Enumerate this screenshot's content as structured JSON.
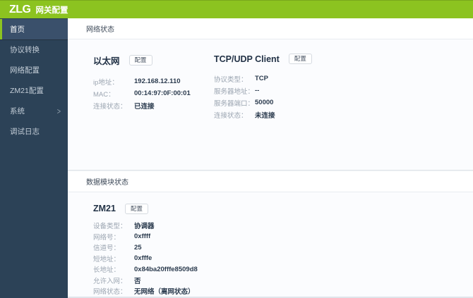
{
  "header": {
    "logo": "ZLG",
    "title": "网关配置"
  },
  "colors": {
    "brand_green": "#8cc320",
    "sidebar_bg": "#2c4257",
    "sidebar_active_bg": "#3a506b",
    "label_gray": "#9ba5b1",
    "value_dark": "#2b3b4e"
  },
  "sidebar": {
    "items": [
      {
        "label": "首页",
        "active": true
      },
      {
        "label": "协议转换",
        "active": false
      },
      {
        "label": "网络配置",
        "active": false
      },
      {
        "label": "ZM21配置",
        "active": false
      },
      {
        "label": "系统",
        "active": false,
        "has_submenu": true
      },
      {
        "label": "调试日志",
        "active": false
      }
    ]
  },
  "panels": [
    {
      "title": "网络状态",
      "sections": [
        {
          "name": "以太网",
          "config_button": "配置",
          "rows": [
            {
              "label": "ip地址：",
              "value": "192.168.12.110"
            },
            {
              "label": "MAC：",
              "value": "00:14:97:0F:00:01"
            },
            {
              "label": "连接状态：",
              "value": "已连接"
            }
          ]
        },
        {
          "name": "TCP/UDP Client",
          "config_button": "配置",
          "rows": [
            {
              "label": "协议类型：",
              "value": "TCP"
            },
            {
              "label": "服务器地址：",
              "value": "--"
            },
            {
              "label": "服务器端口：",
              "value": "50000"
            },
            {
              "label": "连接状态：",
              "value": "未连接"
            }
          ]
        }
      ]
    },
    {
      "title": "数据模块状态",
      "sections": [
        {
          "name": "ZM21",
          "config_button": "配置",
          "rows": [
            {
              "label": "设备类型：",
              "value": "协调器"
            },
            {
              "label": "网络号：",
              "value": "0xffff"
            },
            {
              "label": "信道号：",
              "value": "25"
            },
            {
              "label": "短地址：",
              "value": "0xfffe"
            },
            {
              "label": "长地址：",
              "value": "0x84ba20fffe8509d8"
            },
            {
              "label": "允许入网：",
              "value": "否"
            },
            {
              "label": "网络状态：",
              "value": "无网络（离网状态）"
            }
          ]
        }
      ]
    }
  ]
}
